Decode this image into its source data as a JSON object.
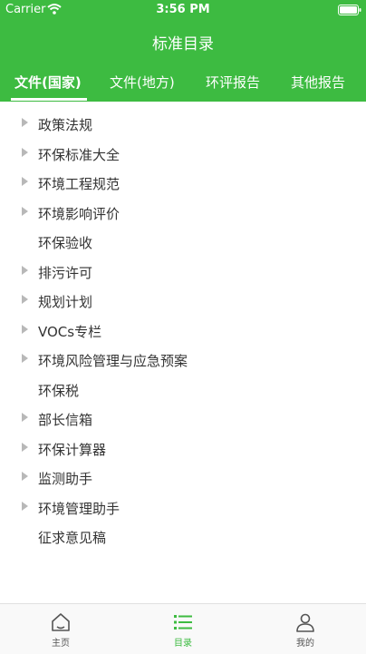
{
  "status_bar": {
    "carrier": "Carrier",
    "time": "3:56 PM"
  },
  "nav": {
    "title": "标准目录"
  },
  "tabs": [
    {
      "label": "文件(国家)",
      "active": true
    },
    {
      "label": "文件(地方)",
      "active": false
    },
    {
      "label": "环评报告",
      "active": false
    },
    {
      "label": "其他报告",
      "active": false
    }
  ],
  "list": [
    {
      "label": "政策法规",
      "expandable": true
    },
    {
      "label": "环保标准大全",
      "expandable": true
    },
    {
      "label": "环境工程规范",
      "expandable": true
    },
    {
      "label": "环境影响评价",
      "expandable": true
    },
    {
      "label": "环保验收",
      "expandable": false
    },
    {
      "label": "排污许可",
      "expandable": true
    },
    {
      "label": "规划计划",
      "expandable": true
    },
    {
      "label": "VOCs专栏",
      "expandable": true
    },
    {
      "label": "环境风险管理与应急预案",
      "expandable": true
    },
    {
      "label": "环保税",
      "expandable": false
    },
    {
      "label": "部长信箱",
      "expandable": true
    },
    {
      "label": "环保计算器",
      "expandable": true
    },
    {
      "label": "监测助手",
      "expandable": true
    },
    {
      "label": "环境管理助手",
      "expandable": true
    },
    {
      "label": "征求意见稿",
      "expandable": false
    }
  ],
  "bottom_tabs": [
    {
      "label": "主页",
      "icon": "home-icon",
      "active": false
    },
    {
      "label": "目录",
      "icon": "list-icon",
      "active": true
    },
    {
      "label": "我的",
      "icon": "user-icon",
      "active": false
    }
  ],
  "colors": {
    "brand": "#3dbb41",
    "arrow": "#b8b8b8",
    "text": "#333333"
  }
}
